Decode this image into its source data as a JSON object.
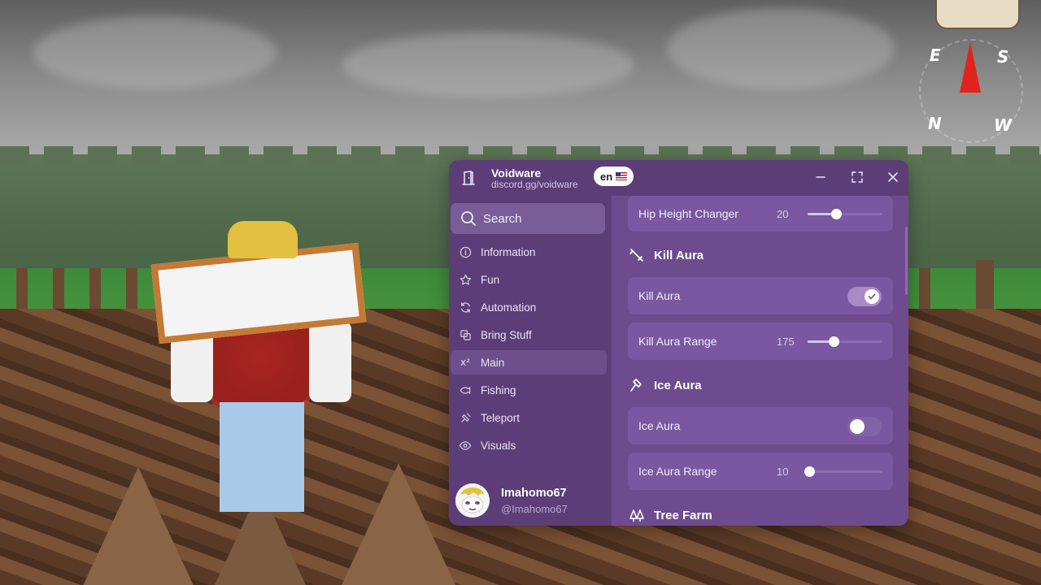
{
  "window": {
    "title": "Voidware",
    "subtitle": "discord.gg/voidware",
    "language": "en",
    "minimize_icon": "minimize-icon",
    "maximize_icon": "maximize-icon",
    "close_icon": "close-icon"
  },
  "search": {
    "label": "Search",
    "icon": "search-icon"
  },
  "nav": [
    {
      "label": "Information",
      "icon": "info-icon",
      "active": false
    },
    {
      "label": "Fun",
      "icon": "star-icon",
      "active": false
    },
    {
      "label": "Automation",
      "icon": "refresh-icon",
      "active": false
    },
    {
      "label": "Bring Stuff",
      "icon": "copy-icon",
      "active": false
    },
    {
      "label": "Main",
      "icon": "superscript-icon",
      "active": true
    },
    {
      "label": "Fishing",
      "icon": "fish-icon",
      "active": false
    },
    {
      "label": "Teleport",
      "icon": "satellite-icon",
      "active": false
    },
    {
      "label": "Visuals",
      "icon": "eye-icon",
      "active": false
    }
  ],
  "user": {
    "name": "Imahomo67",
    "handle": "@Imahomo67"
  },
  "content": {
    "hip_height": {
      "label": "Hip Height Changer",
      "value": "20",
      "fraction": 0.38
    },
    "kill_aura_section": {
      "title": "Kill Aura",
      "icon": "sword-icon"
    },
    "kill_aura_toggle": {
      "label": "Kill Aura",
      "on": true
    },
    "kill_aura_range": {
      "label": "Kill Aura Range",
      "value": "175",
      "fraction": 0.35
    },
    "ice_aura_section": {
      "title": "Ice Aura",
      "icon": "hammer-icon"
    },
    "ice_aura_toggle": {
      "label": "Ice Aura",
      "on": false
    },
    "ice_aura_range": {
      "label": "Ice Aura Range",
      "value": "10",
      "fraction": 0.02
    },
    "tree_farm_section": {
      "title": "Tree Farm",
      "icon": "trees-icon"
    }
  },
  "hud": {
    "compass": {
      "e": "E",
      "s": "S",
      "n": "N",
      "w": "W"
    }
  },
  "colors": {
    "panel_bg": "#5d3d78",
    "content_bg": "#6e4b8f",
    "card_bg": "#7a57a0",
    "accent": "#a88bc6"
  }
}
